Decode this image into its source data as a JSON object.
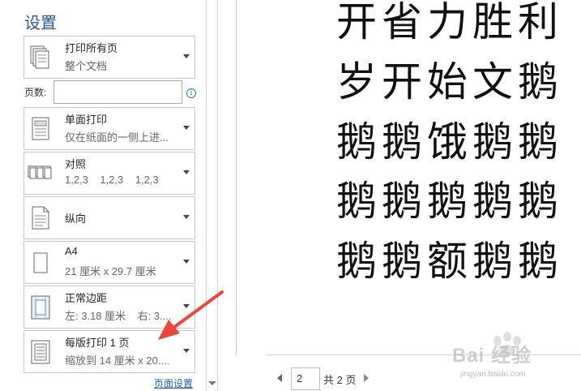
{
  "settings": {
    "title": "设置",
    "print_range": {
      "line1": "打印所有页",
      "line2": "整个文档"
    },
    "pages": {
      "label": "页数:",
      "value": "",
      "placeholder": ""
    },
    "sides": {
      "line1": "单面打印",
      "line2": "仅在纸面的一侧上进..."
    },
    "collate": {
      "line1": "对照",
      "line2": "1,2,3    1,2,3    1,2,3"
    },
    "orientation": {
      "line1": "纵向"
    },
    "paper": {
      "line1": "A4",
      "line2": "21 厘米 x 29.7 厘米"
    },
    "margins": {
      "line1": "正常边距",
      "line2": "左: 3.18 厘米    右: 3...."
    },
    "per_sheet": {
      "line1": "每版打印 1 页",
      "line2": "缩放到 14 厘米 x 20...."
    },
    "page_setup_link": "页面设置"
  },
  "preview": {
    "lines": [
      "开省力胜利",
      "岁开始文鹅",
      "鹅鹅饿鹅鹅",
      "鹅鹅鹅鹅鹅",
      "鹅鹅额鹅鹅"
    ],
    "nav": {
      "current_page": "2",
      "total_label": "共 2 页"
    }
  },
  "watermark": {
    "main": "Bai 经验",
    "sub": "jingyan.baidu.com"
  },
  "colors": {
    "title_blue": "#2b579a",
    "link_blue": "#1e5ea8",
    "arrow_red": "#e8473a"
  }
}
